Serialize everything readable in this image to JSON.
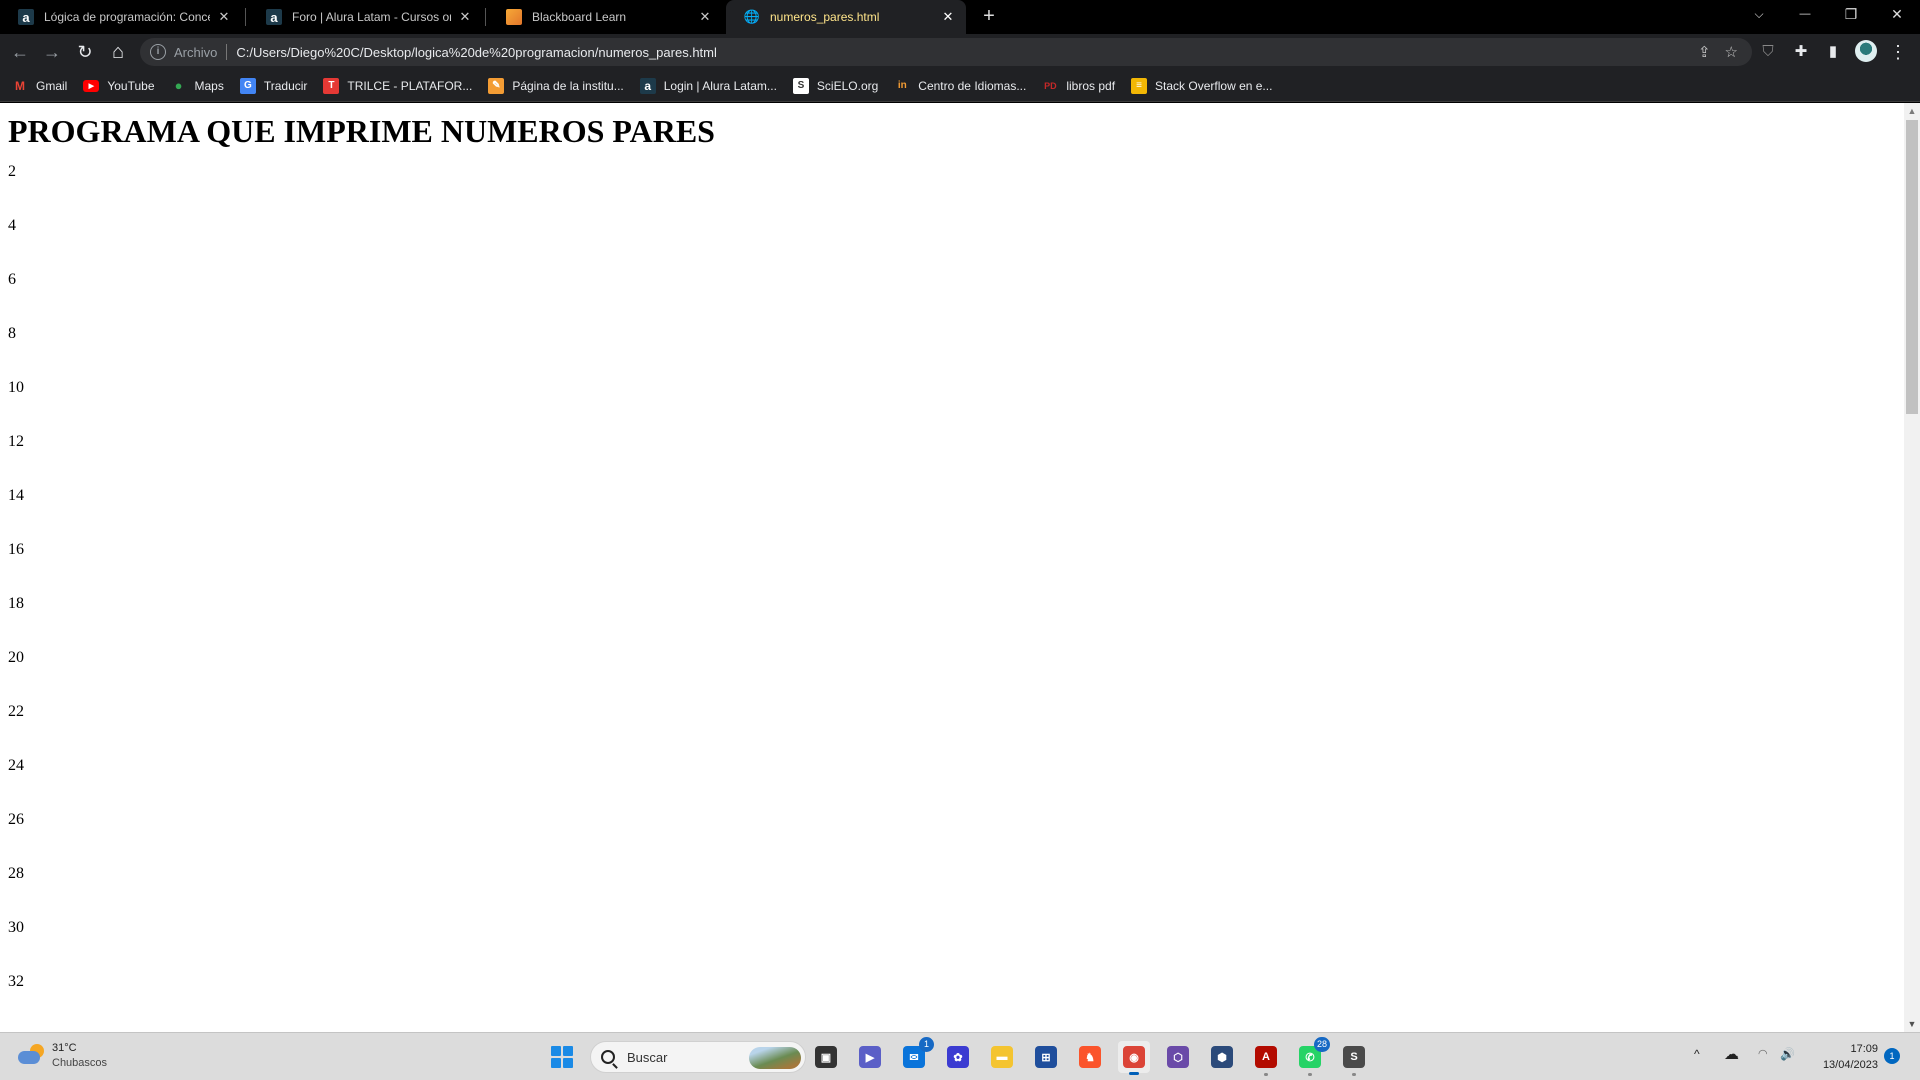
{
  "browser": {
    "tabs": [
      {
        "favicon": "alura-icon",
        "fav_glyph": "a",
        "title": "Lógica de programación: Concep",
        "active": false
      },
      {
        "favicon": "alura-icon",
        "fav_glyph": "a",
        "title": "Foro | Alura Latam - Cursos onlin",
        "active": false
      },
      {
        "favicon": "blackboard-icon",
        "fav_glyph": "",
        "title": "Blackboard Learn",
        "active": false
      },
      {
        "favicon": "globe-icon",
        "fav_glyph": "🌐",
        "title": "numeros_pares.html",
        "active": true
      }
    ],
    "close_glyph": "✕",
    "new_tab_glyph": "+",
    "window_controls": {
      "tab_search": "⌵",
      "minimize": "—",
      "restore": "❐",
      "close": "✕"
    },
    "nav": {
      "back": "←",
      "forward": "→",
      "reload": "↻",
      "home": "⌂"
    },
    "omnibox": {
      "info_glyph": "i",
      "scheme_label": "Archivo",
      "url": "C:/Users/Diego%20C/Desktop/logica%20de%20programacion/numeros_pares.html",
      "share_glyph": "⇪",
      "star_glyph": "☆"
    },
    "toolbar_icons": {
      "extension_shield": "⛉",
      "extensions": "✚",
      "side_panel": "▮",
      "menu": "⋮"
    },
    "bookmarks": [
      {
        "label": "Gmail",
        "icon": "gmail-icon",
        "glyph": "M",
        "color": "#ea4335",
        "bg": "transparent"
      },
      {
        "label": "YouTube",
        "icon": "youtube-icon",
        "glyph": "▶",
        "color": "#ffffff",
        "bg": "#ff0000"
      },
      {
        "label": "Maps",
        "icon": "maps-icon",
        "glyph": "●",
        "color": "#34a853",
        "bg": "transparent"
      },
      {
        "label": "Traducir",
        "icon": "translate-icon",
        "glyph": "G",
        "color": "#ffffff",
        "bg": "#4285f4"
      },
      {
        "label": "TRILCE - PLATAFOR...",
        "icon": "trilce-icon",
        "glyph": "T",
        "color": "#ffffff",
        "bg": "#e53935"
      },
      {
        "label": "Página de la institu...",
        "icon": "pencil-icon",
        "glyph": "✎",
        "color": "#ffffff",
        "bg": "#f39c34"
      },
      {
        "label": "Login | Alura Latam...",
        "icon": "alura-icon",
        "glyph": "a",
        "color": "#ffffff",
        "bg": "#1d3a4a"
      },
      {
        "label": "SciELO.org",
        "icon": "scielo-icon",
        "glyph": "S",
        "color": "#333333",
        "bg": "#ffffff"
      },
      {
        "label": "Centro de Idiomas...",
        "icon": "idiomas-icon",
        "glyph": "in",
        "color": "#f39c34",
        "bg": "transparent"
      },
      {
        "label": "libros pdf",
        "icon": "pdf-icon",
        "glyph": "PD",
        "color": "#c62828",
        "bg": "transparent"
      },
      {
        "label": "Stack Overflow en e...",
        "icon": "stackoverflow-icon",
        "glyph": "≡",
        "color": "#ffffff",
        "bg": "#f2b705"
      }
    ]
  },
  "page": {
    "heading": "PROGRAMA QUE IMPRIME NUMEROS PARES",
    "numbers": [
      "2",
      "4",
      "6",
      "8",
      "10",
      "12",
      "14",
      "16",
      "18",
      "20",
      "22",
      "24",
      "26",
      "28",
      "30",
      "32"
    ],
    "scroll": {
      "up_glyph": "▲",
      "down_glyph": "▼"
    }
  },
  "taskbar": {
    "weather": {
      "temp": "31°C",
      "condition": "Chubascos"
    },
    "search_placeholder": "Buscar",
    "apps": [
      {
        "name": "task-view",
        "glyph": "▣",
        "bg": "#333333",
        "badge": "",
        "state": "none"
      },
      {
        "name": "teams-chat",
        "glyph": "▶",
        "bg": "#5b5fc7",
        "badge": "",
        "state": "none"
      },
      {
        "name": "mail",
        "glyph": "✉",
        "bg": "#0a74da",
        "badge": "1",
        "state": "none"
      },
      {
        "name": "eclipse-ide",
        "glyph": "✿",
        "bg": "#3b3bd1",
        "badge": "",
        "state": "none"
      },
      {
        "name": "file-explorer",
        "glyph": "▬",
        "bg": "#f4c430",
        "badge": "",
        "state": "none"
      },
      {
        "name": "microsoft-store",
        "glyph": "⊞",
        "bg": "#1f4e9c",
        "badge": "",
        "state": "none"
      },
      {
        "name": "brave-browser",
        "glyph": "♞",
        "bg": "#fb542b",
        "badge": "",
        "state": "none"
      },
      {
        "name": "chrome",
        "glyph": "◉",
        "bg": "#db4437",
        "badge": "",
        "state": "active"
      },
      {
        "name": "virtualbox-cube",
        "glyph": "⬡",
        "bg": "#6a4aa8",
        "badge": "",
        "state": "none"
      },
      {
        "name": "cube-app",
        "glyph": "⬢",
        "bg": "#2b4a7a",
        "badge": "",
        "state": "none"
      },
      {
        "name": "acrobat-reader",
        "glyph": "A",
        "bg": "#b30b00",
        "badge": "",
        "state": "running"
      },
      {
        "name": "whatsapp",
        "glyph": "✆",
        "bg": "#25d366",
        "badge": "28",
        "state": "running"
      },
      {
        "name": "sublime-text",
        "glyph": "S",
        "bg": "#4a4a4a",
        "badge": "",
        "state": "running"
      }
    ],
    "tray": {
      "chevron": "^",
      "onedrive": "☁",
      "wifi": "◠",
      "volume": "🔊"
    },
    "time": "17:09",
    "date": "13/04/2023",
    "notifications": "1"
  }
}
